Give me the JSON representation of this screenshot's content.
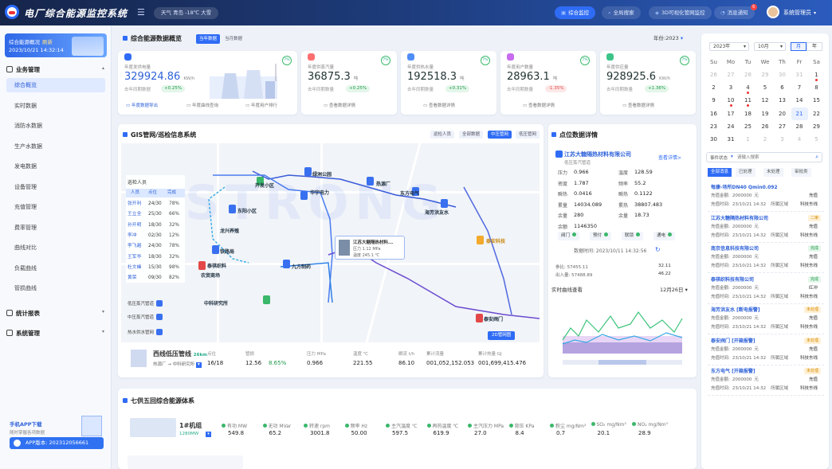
{
  "app": {
    "title": "电厂综合能源监控系统",
    "weather": "天气  青岛  -18℃  大雪",
    "user": "系统管理员"
  },
  "top_buttons": [
    {
      "label": "综合监控",
      "icon": "monitor-icon"
    },
    {
      "label": "全局搜索",
      "icon": "search-icon"
    },
    {
      "label": "3D可视化管网监控",
      "icon": "cube-icon"
    },
    {
      "label": "消息通知",
      "icon": "bell-icon"
    }
  ],
  "notify_count": "6",
  "sidebar": {
    "banner_title": "综合能源概况",
    "banner_refresh": "刷新",
    "banner_time": "2023/10/21 14:32:14",
    "group_business": "业务管理",
    "items": [
      "综合概览",
      "实时数据",
      "消防水数据",
      "生产水数据",
      "发电数据",
      "设备管理",
      "充值管理",
      "费率管理",
      "曲线对比",
      "负载曲线",
      "管损曲线"
    ],
    "group_stats": "统计报表",
    "group_system": "系统管理",
    "app_download": "手机APP下载",
    "app_sub": "随时掌握各项数据",
    "app_version": "APP版本: 202312056661"
  },
  "overview": {
    "title": "综合能源数据概览",
    "tab_current": "当年数据",
    "tab_month": "当月数据",
    "year_select": "年份:2023"
  },
  "kpis": [
    {
      "label": "年度发供电量",
      "value": "329924.86",
      "unit": "KW/h",
      "sub": "去年同期数据",
      "pct": "+0.25%",
      "trend": "up",
      "ring": "7%"
    },
    {
      "label": "年度供蒸汽量",
      "value": "36875.3",
      "unit": "吨",
      "sub": "去年同期数量",
      "pct": "+0.25%",
      "trend": "up",
      "ring": "7%",
      "foot": "查看数据详情"
    },
    {
      "label": "年度供热水量",
      "value": "192518.3",
      "unit": "吨",
      "sub": "去年同期数量",
      "pct": "+0.31%",
      "trend": "up",
      "ring": "7%",
      "foot": "查看数据详情"
    },
    {
      "label": "年度用户数量",
      "value": "28963.1",
      "unit": "吨",
      "sub": "去年同期数量",
      "pct": "-1.35%",
      "trend": "down",
      "ring": "7%",
      "foot": "查看数据详情"
    },
    {
      "label": "年度供应量",
      "value": "928925.6",
      "unit": "KW/h",
      "sub": "去年同期数量",
      "pct": "+1.36%",
      "trend": "up",
      "ring": "7%",
      "foot": "查看数据详情"
    }
  ],
  "kpi1_links": [
    "年度数据导出",
    "年度曲线查询",
    "年度用户排行"
  ],
  "calendar": {
    "year": "2023年",
    "month": "10月",
    "toggle_month": "月",
    "toggle_year": "年",
    "weekdays": [
      "Su",
      "Mo",
      "Tu",
      "We",
      "Th",
      "Fr",
      "Sa"
    ],
    "rows": [
      [
        "26",
        "27",
        "28",
        "29",
        "30",
        "31",
        "1"
      ],
      [
        "2",
        "3",
        "4",
        "5",
        "6",
        "7",
        "8"
      ],
      [
        "9",
        "10",
        "11",
        "12",
        "13",
        "14",
        "15"
      ],
      [
        "16",
        "17",
        "18",
        "19",
        "20",
        "21",
        "22"
      ],
      [
        "23",
        "24",
        "25",
        "26",
        "27",
        "28",
        "29"
      ],
      [
        "30",
        "31",
        "1",
        "2",
        "3",
        "4",
        "5"
      ]
    ],
    "today": "21",
    "search_label": "事件状态",
    "search_placeholder": "请输入搜索",
    "tabs": [
      "全部消息",
      "已处理",
      "未处理",
      "审批类"
    ]
  },
  "events": [
    {
      "name": "每康-场所DN40 Qmin0.092",
      "tag": "",
      "l1": "充值金额:",
      "v1": "2000000",
      "u1": "元",
      "s1": "充值",
      "l2": "充值时间:",
      "t2": "23/10/21 14:32",
      "p2": "所属区域",
      "a2": "科技东线"
    },
    {
      "name": "江苏大糖隔热材料有限公司",
      "tag": "二审",
      "l1": "充值金额:",
      "v1": "2000000",
      "u1": "元",
      "s1": "充值",
      "l2": "充值时间:",
      "t2": "23/10/21 14:32",
      "p2": "所属区域",
      "a2": "科技东线"
    },
    {
      "name": "南京信息科技有限公司",
      "tag": "完成",
      "l1": "充值金额:",
      "v1": "2000000",
      "u1": "元",
      "s1": "充值",
      "l2": "充值时间:",
      "t2": "23/10/21 14:32",
      "p2": "所属区域",
      "a2": "科技东线"
    },
    {
      "name": "泰祺织料技有限公司",
      "tag": "完成",
      "l1": "充值金额:",
      "v1": "2000000",
      "u1": "元",
      "s1": "红冲",
      "l2": "充值时间:",
      "t2": "23/10/21 14:32",
      "p2": "所属区域",
      "a2": "科技东线"
    },
    {
      "name": "海芳洪友水 [断电报警]",
      "tag": "未处理",
      "l1": "充值金额:",
      "v1": "2000000",
      "u1": "元",
      "s1": "充值",
      "l2": "充值时间:",
      "t2": "23/10/21 14:32",
      "p2": "所属区域",
      "a2": "科技东线"
    },
    {
      "name": "泰安阀门 [开箱报警]",
      "tag": "未处理",
      "l1": "充值金额:",
      "v1": "2000000",
      "u1": "元",
      "s1": "充值",
      "l2": "充值时间:",
      "t2": "23/10/21 14:32",
      "p2": "所属区域",
      "a2": "科技东线"
    },
    {
      "name": "东方电气 [开箱报警]",
      "tag": "未处理",
      "l1": "充值金额:",
      "v1": "2000000",
      "u1": "元",
      "s1": "充值",
      "l2": "充值时间:",
      "t2": "23/10/21 14:32",
      "p2": "所属区域",
      "a2": "科技东线"
    }
  ],
  "gis": {
    "title": "GIS管网/巡检信息系统",
    "tabs": [
      "巡检人员",
      "全部数据",
      "中压管网",
      "低压管网"
    ],
    "inspect_title": "巡检人员",
    "inspect_heads": [
      "人员",
      "点位",
      "完成"
    ],
    "inspectors": [
      {
        "name": "张开利",
        "pts": "24/30",
        "pct": "78%"
      },
      {
        "name": "王立全",
        "pts": "25/30",
        "pct": "66%"
      },
      {
        "name": "孙开明",
        "pts": "18/30",
        "pct": "32%"
      },
      {
        "name": "李冲",
        "pts": "02/30",
        "pct": "12%"
      },
      {
        "name": "李飞越",
        "pts": "24/30",
        "pct": "78%"
      },
      {
        "name": "王军华",
        "pts": "18/30",
        "pct": "32%"
      },
      {
        "name": "杜文峰",
        "pts": "15/30",
        "pct": "98%"
      },
      {
        "name": "黄荣",
        "pts": "09/30",
        "pct": "82%"
      }
    ],
    "legend": [
      "低压蒸汽管道",
      "中压蒸汽管道",
      "热水供水管网"
    ],
    "map_labels": [
      "绿洲公园",
      "热源厂",
      "开发小区",
      "东阳小区",
      "龙兴养殖",
      "铁路局",
      "泰祺织料",
      "农贸商场",
      "九方制药",
      "中科研究所",
      "东方电气",
      "海芳洪友水",
      "泰安阀门",
      "泰安科技",
      "华宇电力"
    ],
    "popup_title": "江苏大糖隔热材料...",
    "popup_l1": "压力",
    "popup_v1": "1.12",
    "popup_u1": "MPa",
    "popup_l2": "温度",
    "popup_v2": "245.1",
    "popup_u2": "℃",
    "btn_2d": "2D管网图",
    "pipe_name": "西线低压管线",
    "pipe_len": "26km",
    "pipe_from": "热源厂",
    "pipe_to": "中科研究所",
    "pipe_stats": [
      {
        "label": "点位",
        "value": "16/18"
      },
      {
        "label": "管损",
        "value": "12.56"
      },
      {
        "label": "",
        "value": "8.65%"
      },
      {
        "label": "压力 MPa",
        "value": "0.966"
      },
      {
        "label": "温度 ℃",
        "value": "221.55"
      },
      {
        "label": "瞬流 t/h",
        "value": "86.10"
      },
      {
        "label": "累计流量",
        "value": "001,052,152.053"
      },
      {
        "label": "累计热量 GJ",
        "value": "001,699,415.476"
      }
    ]
  },
  "point": {
    "title": "点位数据详情",
    "company": "江苏大糖隔热材料有限公司",
    "sub": "低压蒸汽管道",
    "more": "查看详情>",
    "fields": [
      [
        "压力",
        "0.966"
      ],
      [
        "温度",
        "128.59"
      ],
      [
        "密度",
        "1.787"
      ],
      [
        "频率",
        "55.2"
      ],
      [
        "瞬热",
        "0.0416"
      ],
      [
        "瞬热",
        "0.1122"
      ],
      [
        "累量",
        "14034.089"
      ],
      [
        "累热",
        "38807.483"
      ],
      [
        "余量",
        "280"
      ],
      [
        "余量",
        "18.73"
      ],
      [
        "余额",
        "1146350"
      ]
    ],
    "buttons": [
      "阀门",
      "预付",
      "联锁",
      "通电"
    ],
    "update_time": "数据时间: 2023/10/11 14:32:56",
    "stats": [
      "参比: 57455.11",
      "32.11",
      "出入量: 57488.89",
      "46.22"
    ],
    "chart_title": "实时曲线查看",
    "chart_date": "12月26日"
  },
  "bottom": {
    "title": "七供五回综合能源体系",
    "unit_name": "1#机组",
    "unit_sub": "1280MW",
    "fields": [
      {
        "label": "有功 MW",
        "value": "549.8"
      },
      {
        "label": "无功 MVar",
        "value": "65.2"
      },
      {
        "label": "转速 rpm",
        "value": "3001.8"
      },
      {
        "label": "频率 Hz",
        "value": "50.00"
      },
      {
        "label": "主汽温度 ℃",
        "value": "597.5"
      },
      {
        "label": "再热温度 ℃",
        "value": "619.9"
      },
      {
        "label": "主汽压力 MPa",
        "value": "27.0"
      },
      {
        "label": "背压 KPa",
        "value": "8.4"
      },
      {
        "label": "粉尘 mg/Nm³",
        "value": "0.7"
      },
      {
        "label": "SO₂ mg/Nm³",
        "value": "20.1"
      },
      {
        "label": "NO₂ mg/Nm³",
        "value": "28.9"
      }
    ]
  }
}
